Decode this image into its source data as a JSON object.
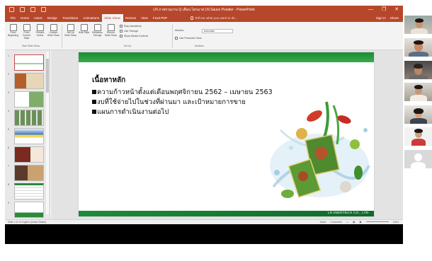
{
  "window": {
    "title": "LN ภาพรวมงาน Q เดือน ไตรมาส LN Sauce Powder - PowerPoint",
    "controls": [
      "—",
      "❐",
      "✕"
    ]
  },
  "ribbon_tabs": [
    "File",
    "Home",
    "Insert",
    "Design",
    "Transitions",
    "Animations",
    "Slide Show",
    "Review",
    "View",
    "Foxit PDF"
  ],
  "active_tab": "Slide Show",
  "tell_me": "Tell me what you want to do...",
  "account": {
    "sign_in": "Sign in",
    "share": "Share"
  },
  "ribbon": {
    "start_group": {
      "buttons": [
        "From Beginning",
        "From Current Slide",
        "Present Online",
        "Custom Slide Show"
      ],
      "label": "Start Slide Show"
    },
    "setup_group": {
      "buttons": [
        "Set Up Slide Show",
        "Hide Slide",
        "Rehearse Timings",
        "Record Slide Show"
      ],
      "checks": [
        "Play Narrations",
        "Use Timings",
        "Show Media Controls"
      ],
      "label": "Set Up"
    },
    "monitors_group": {
      "monitor_label": "Monitor:",
      "monitor_value": "Automatic",
      "presenter_view": "Use Presenter View",
      "label": "Monitors"
    }
  },
  "thumbnails": [
    {
      "num": "1"
    },
    {
      "num": "2"
    },
    {
      "num": "3"
    },
    {
      "num": "4"
    },
    {
      "num": "5"
    },
    {
      "num": "6"
    },
    {
      "num": "7"
    },
    {
      "num": "8"
    },
    {
      "num": "9"
    }
  ],
  "slide": {
    "heading": "เนื้อหาหลัก",
    "bullets": [
      "ความก้าวหน้าตั้งแต่เดือนพฤศจิกายน 2562 – เมษายน 2563",
      "งบที่ใช้จ่ายไปในช่วงที่ผ่านมา และเป้าหมายการขาย",
      "แผนการดำเนินงานต่อไป"
    ],
    "footer": "LN INNOTECH CO., LTD."
  },
  "status": {
    "left": "Slide 1 of 11    English (United States)",
    "notes": "Notes",
    "comments": "Comments",
    "zoom": "116%"
  },
  "colors": {
    "accent": "#b7472a",
    "slide_green": "#2c8a3c"
  }
}
